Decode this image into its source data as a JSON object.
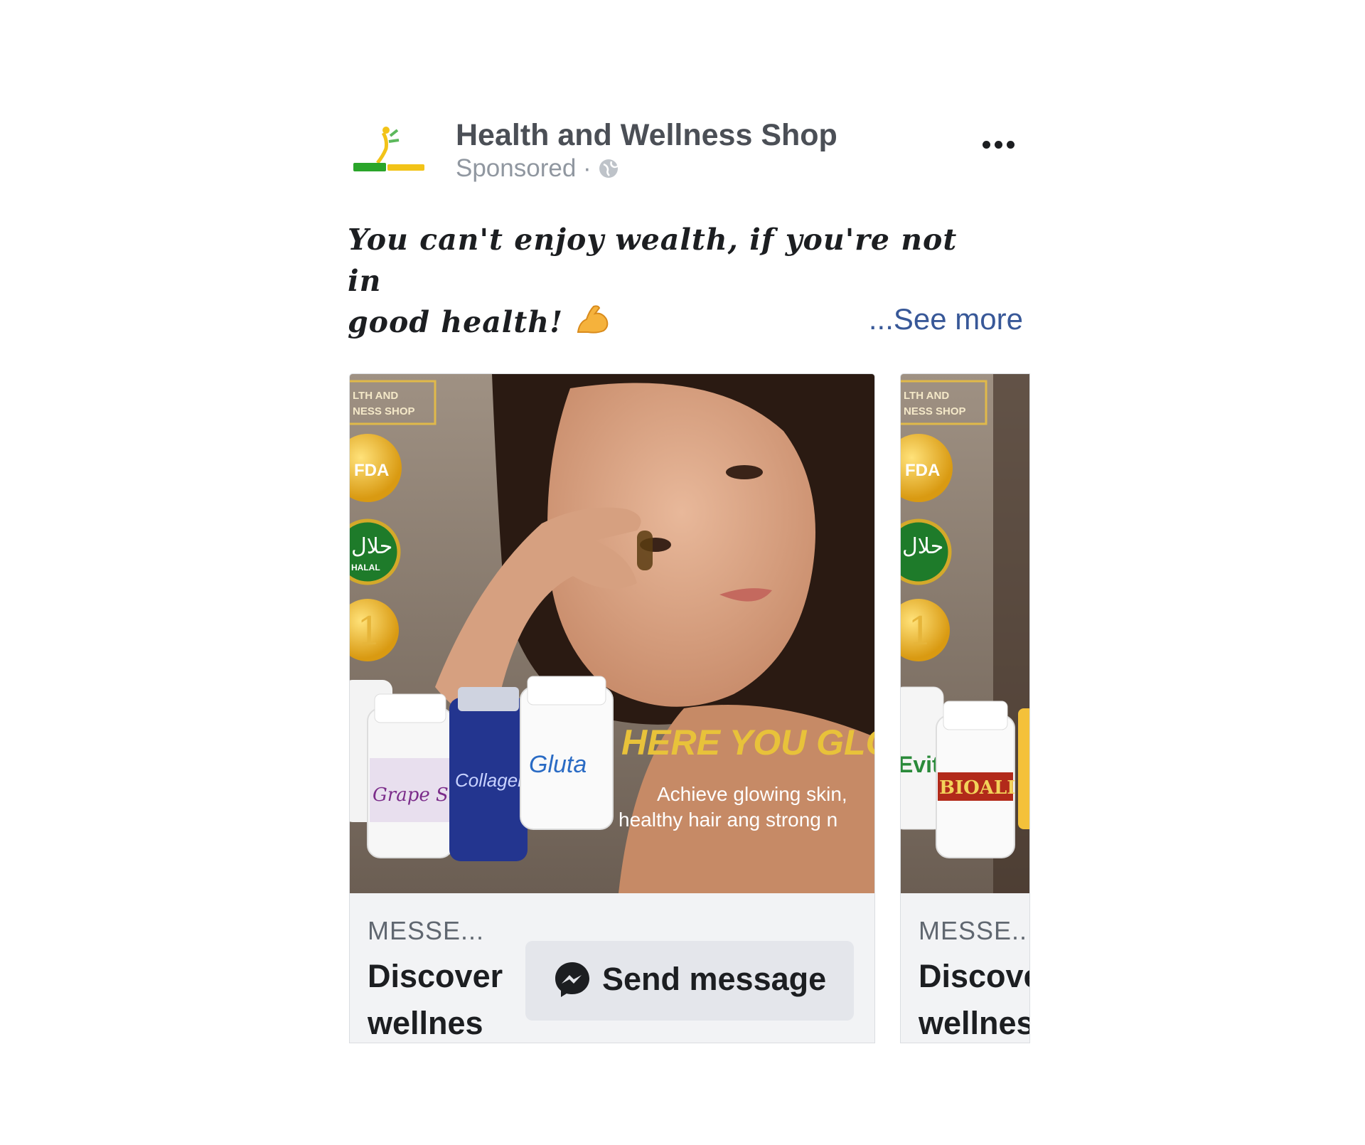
{
  "post": {
    "page_name": "Health and Wellness Shop",
    "sponsored_label": "Sponsored ·",
    "caption_line1": "You can't enjoy wealth, if you're not in",
    "caption_line2": "good health!",
    "see_more": "...See more",
    "icons": [
      "brand-logo",
      "globe-icon",
      "more-options-icon",
      "flexed-biceps-emoji",
      "messenger-icon"
    ]
  },
  "carousel": {
    "cards": [
      {
        "badge_text_1": "LTH AND",
        "badge_text_2": "NESS SHOP",
        "seal_fda": "FDA",
        "seal_halal": "حلال",
        "seal_halal_sub": "HALAL",
        "seal_number": "1",
        "headline": "HERE YOU GLO",
        "subtext_line1": "Achieve glowing skin,",
        "subtext_line2": "healthy hair ang strong n",
        "bottle_labels": [
          "Grape Seed",
          "Collagen",
          "Gluta"
        ],
        "link_label": "MESSE...",
        "link_title": "Discover wellnes",
        "cta_label": "Send message"
      },
      {
        "badge_text_1": "LTH AND",
        "badge_text_2": "NESS SHOP",
        "seal_fda": "FDA",
        "seal_halal": "حلال",
        "seal_number": "1",
        "bottle_labels": [
          "Evita",
          "BIOALI"
        ],
        "link_label": "MESSE...",
        "link_title": "Discover wellnes"
      }
    ]
  },
  "colors": {
    "link_blue": "#385898",
    "headline_gold": "#e8c23a",
    "button_bg": "#e4e6eb",
    "footer_bg": "#f2f3f5",
    "photo_bg": "#a89a8a"
  }
}
